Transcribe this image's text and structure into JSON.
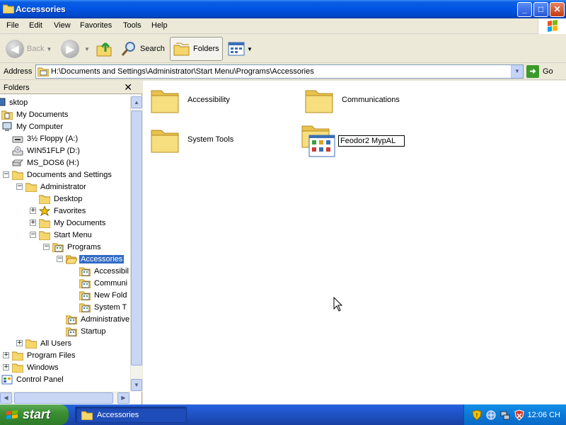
{
  "window": {
    "title": "Accessories",
    "controls": {
      "minimize": "_",
      "maximize": "□",
      "close": "✕"
    }
  },
  "menu": [
    "File",
    "Edit",
    "View",
    "Favorites",
    "Tools",
    "Help"
  ],
  "toolbar": {
    "back": "Back",
    "forward": "",
    "search": "Search",
    "folders": "Folders"
  },
  "address": {
    "label": "Address",
    "path": "H:\\Documents and Settings\\Administrator\\Start Menu\\Programs\\Accessories",
    "go": "Go"
  },
  "folder_pane": {
    "title": "Folders",
    "close": "✕",
    "tree": [
      {
        "label": "sktop",
        "depth": 0,
        "icon": "desktop-icon"
      },
      {
        "label": "My Documents",
        "depth": 0,
        "icon": "my-documents-icon"
      },
      {
        "label": "My Computer",
        "depth": 0,
        "icon": "my-computer-icon"
      },
      {
        "label": "3½ Floppy (A:)",
        "depth": 1,
        "icon": "floppy-drive-icon"
      },
      {
        "label": "WIN51FLP (D:)",
        "depth": 1,
        "icon": "cd-drive-icon"
      },
      {
        "label": "MS_DOS6 (H:)",
        "depth": 1,
        "icon": "hard-drive-icon"
      },
      {
        "label": "Documents and Settings",
        "depth": 1,
        "icon": "folder-icon",
        "expander": "−"
      },
      {
        "label": "Administrator",
        "depth": 2,
        "icon": "folder-icon",
        "expander": "−"
      },
      {
        "label": "Desktop",
        "depth": 3,
        "icon": "folder-icon"
      },
      {
        "label": "Favorites",
        "depth": 3,
        "icon": "favorites-star-icon",
        "expander": "+"
      },
      {
        "label": "My Documents",
        "depth": 3,
        "icon": "folder-icon",
        "expander": "+"
      },
      {
        "label": "Start Menu",
        "depth": 3,
        "icon": "folder-icon",
        "expander": "−"
      },
      {
        "label": "Programs",
        "depth": 4,
        "icon": "program-group-icon",
        "expander": "−"
      },
      {
        "label": "Accessories",
        "depth": 5,
        "icon": "folder-open-icon",
        "expander": "−",
        "selected": true
      },
      {
        "label": "Accessibil",
        "depth": 6,
        "icon": "program-group-icon"
      },
      {
        "label": "Communi",
        "depth": 6,
        "icon": "program-group-icon"
      },
      {
        "label": "New Fold",
        "depth": 6,
        "icon": "program-group-icon"
      },
      {
        "label": "System T",
        "depth": 6,
        "icon": "program-group-icon"
      },
      {
        "label": "Administrative",
        "depth": 5,
        "icon": "program-group-icon"
      },
      {
        "label": "Startup",
        "depth": 5,
        "icon": "program-group-icon"
      },
      {
        "label": "All Users",
        "depth": 2,
        "icon": "folder-icon",
        "expander": "+"
      },
      {
        "label": "Program Files",
        "depth": 1,
        "icon": "folder-icon",
        "expander": "+"
      },
      {
        "label": "Windows",
        "depth": 1,
        "icon": "folder-icon",
        "expander": "+"
      },
      {
        "label": "Control Panel",
        "depth": 0,
        "icon": "control-panel-icon"
      }
    ]
  },
  "content": {
    "items": [
      {
        "label": "Accessibility"
      },
      {
        "label": "Communications"
      },
      {
        "label": "System Tools"
      }
    ],
    "renaming": {
      "value": "Feodor2 MypAL"
    }
  },
  "taskbar": {
    "start": "start",
    "task": "Accessories",
    "clock": "12:06 CH"
  },
  "colors": {
    "title_bar": "#0054E3",
    "selection": "#316AC5",
    "taskbar": "#245EDB",
    "start_button": "#3C8F35",
    "folder": "#F5D66B"
  }
}
